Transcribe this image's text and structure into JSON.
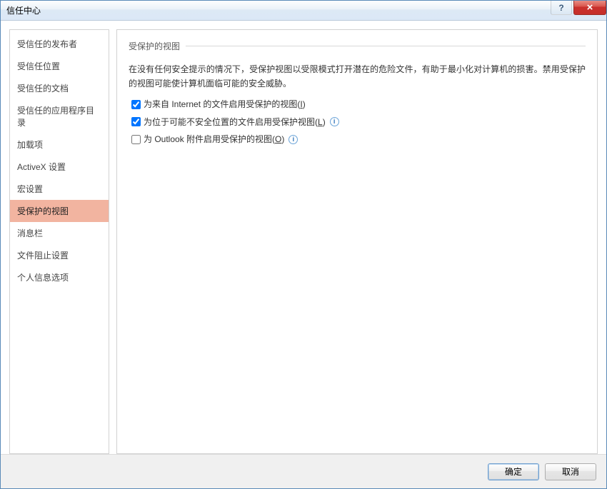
{
  "window": {
    "title": "信任中心",
    "help_symbol": "?",
    "close_symbol": "×"
  },
  "sidebar": {
    "items": [
      {
        "label": "受信任的发布者"
      },
      {
        "label": "受信任位置"
      },
      {
        "label": "受信任的文档"
      },
      {
        "label": "受信任的应用程序目录"
      },
      {
        "label": "加载项"
      },
      {
        "label": "ActiveX 设置"
      },
      {
        "label": "宏设置"
      },
      {
        "label": "受保护的视图",
        "selected": true
      },
      {
        "label": "消息栏"
      },
      {
        "label": "文件阻止设置"
      },
      {
        "label": "个人信息选项"
      }
    ]
  },
  "main": {
    "section_title": "受保护的视图",
    "description": "在没有任何安全提示的情况下，受保护视图以受限模式打开潜在的危险文件，有助于最小化对计算机的损害。禁用受保护的视图可能使计算机面临可能的安全威胁。",
    "options": [
      {
        "label_pre": "为来自 Internet 的文件启用受保护的视图(",
        "accel": "I",
        "label_post": ")",
        "checked": true,
        "info": false
      },
      {
        "label_pre": "为位于可能不安全位置的文件启用受保护视图(",
        "accel": "L",
        "label_post": ")",
        "checked": true,
        "info": true
      },
      {
        "label_pre": "为 Outlook 附件启用受保护的视图(",
        "accel": "O",
        "label_post": ")",
        "checked": false,
        "info": true
      }
    ]
  },
  "buttons": {
    "ok": "确定",
    "cancel": "取消"
  },
  "info_symbol": "i"
}
